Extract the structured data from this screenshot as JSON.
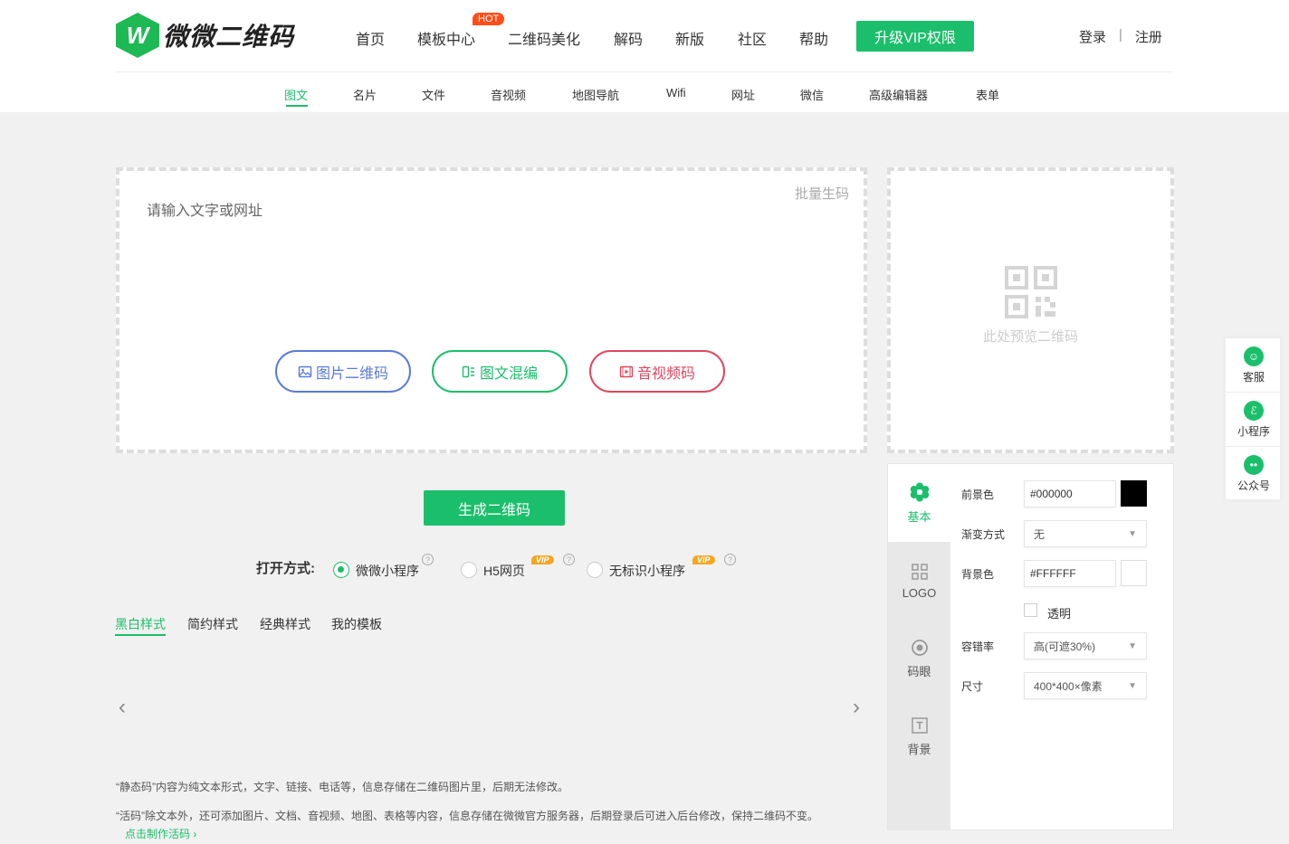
{
  "brand": {
    "logo_letter": "W",
    "name": "微微二维码"
  },
  "nav": {
    "items": [
      "首页",
      "模板中心",
      "二维码美化",
      "解码",
      "新版",
      "社区",
      "帮助"
    ],
    "hot_badge": "HOT",
    "vip_button": "升级VIP权限",
    "login": "登录",
    "separator": "|",
    "register": "注册"
  },
  "subnav": {
    "items": [
      "图文",
      "名片",
      "文件",
      "音视频",
      "地图导航",
      "Wifi",
      "网址",
      "微信",
      "高级编辑器",
      "表单"
    ],
    "active_index": 0
  },
  "editor": {
    "placeholder": "请输入文字或网址",
    "batch_label": "批量生码",
    "pills": [
      "图片二维码",
      "图文混编",
      "音视频码"
    ]
  },
  "preview": {
    "text": "此处预览二维码"
  },
  "generate_button": "生成二维码",
  "open_mode": {
    "label": "打开方式:",
    "options": [
      "微微小程序",
      "H5网页",
      "无标识小程序"
    ],
    "selected_index": 0,
    "vip_badge": "VIP",
    "help_mark": "?"
  },
  "style_tabs": {
    "items": [
      "黑白样式",
      "简约样式",
      "经典样式",
      "我的模板"
    ],
    "active_index": 0
  },
  "carousel": {
    "prev": "‹",
    "next": "›"
  },
  "notes": {
    "static": "“静态码”内容为纯文本形式，文字、链接、电话等，信息存储在二维码图片里，后期无法修改。",
    "live": "“活码”除文本外，还可添加图片、文档、音视频、地图、表格等内容，信息存储在微微官方服务器，后期登录后可进入后台修改，保持二维码不变。",
    "link": "点击制作活码 ›"
  },
  "side_tabs": {
    "items": [
      "基本",
      "LOGO",
      "码眼",
      "背景"
    ],
    "active_index": 0
  },
  "settings": {
    "fg_label": "前景色",
    "fg_value": "#000000",
    "gradient_label": "渐变方式",
    "gradient_value": "无",
    "bg_label": "背景色",
    "bg_value": "#FFFFFF",
    "transparent_label": "透明",
    "ec_label": "容错率",
    "ec_value": "高(可遮30%)",
    "size_label": "尺寸",
    "size_value": "400*400×像素"
  },
  "float_bar": {
    "items": [
      "客服",
      "小程序",
      "公众号"
    ]
  },
  "colors": {
    "accent": "#1bbf6b",
    "hot": "#ff4d1a",
    "vip": "#f5a623",
    "blue_pill": "#5b7ad8",
    "red_pill": "#e0475f"
  }
}
